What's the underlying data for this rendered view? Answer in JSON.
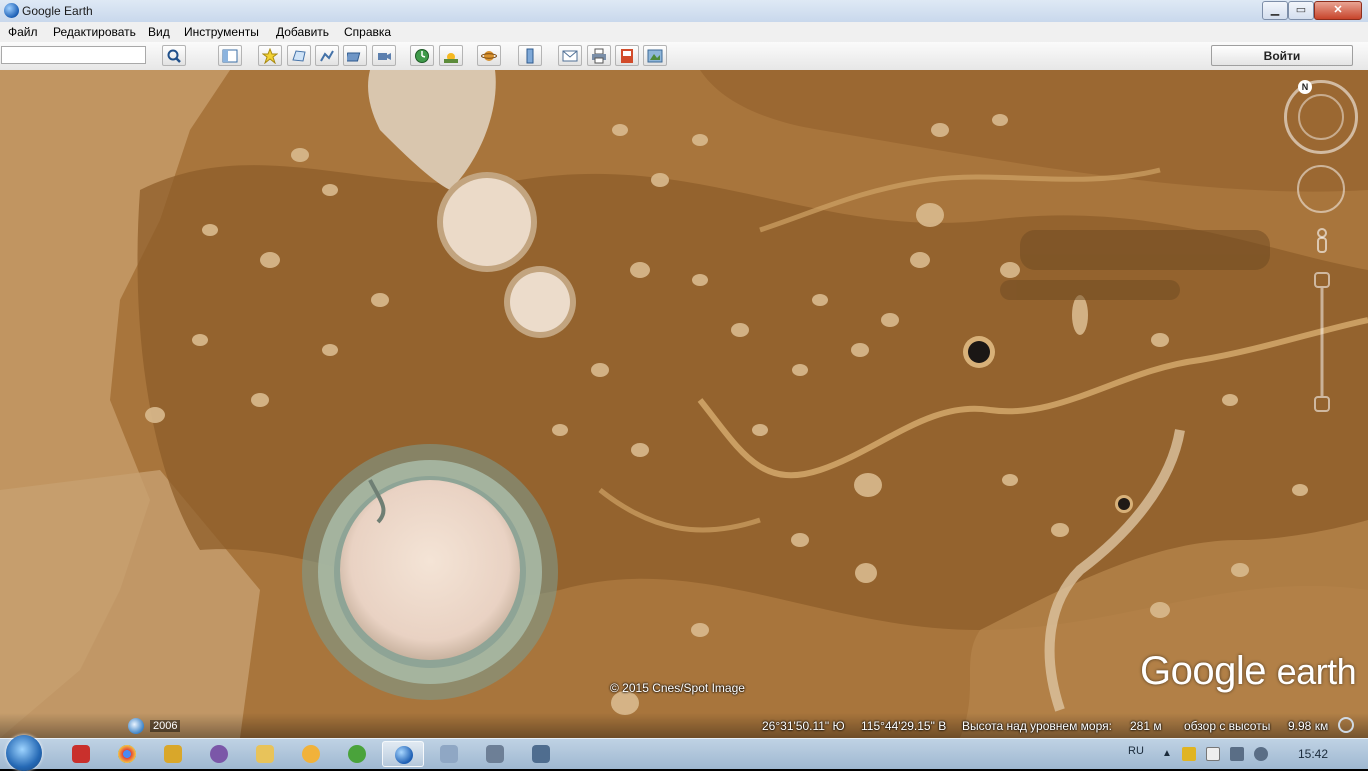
{
  "window": {
    "title": "Google Earth",
    "min_label": "▁",
    "max_label": "▭",
    "close_label": "✕"
  },
  "menu": [
    "Файл",
    "Редактировать",
    "Вид",
    "Инструменты",
    "Добавить",
    "Справка"
  ],
  "toolbar": {
    "search_value": "",
    "signin_label": "Войти",
    "icons": [
      "search-icon",
      "sidebar-toggle-icon",
      "placemark-icon",
      "polygon-icon",
      "path-icon",
      "overlay-icon",
      "tour-record-icon",
      "historical-imagery-icon",
      "sunlight-icon",
      "planets-icon",
      "ruler-icon",
      "email-icon",
      "print-icon",
      "save-image-icon",
      "view-in-maps-icon"
    ]
  },
  "map": {
    "copyright": "© 2015 Cnes/Spot Image",
    "logo_google": "Google",
    "logo_earth": "earth",
    "north_label": "N"
  },
  "status": {
    "imagery_year": "2006",
    "latitude": "26°31'50.11\" Ю",
    "longitude": "115°44'29.15\" В",
    "elevation_label": "Высота над уровнем моря:",
    "elevation_value": "281 м",
    "eye_alt_label": "обзор с высоты",
    "eye_alt_value": "9.98 км"
  },
  "taskbar": {
    "apps": [
      "flash-player-icon",
      "chrome-icon",
      "network-tool-icon",
      "viber-icon",
      "explorer-icon",
      "messenger-icon",
      "utorrent-icon",
      "google-earth-icon",
      "search-tool-icon",
      "usb-device-icon",
      "screen-tool-icon"
    ],
    "active_index": 7,
    "lang": "RU",
    "clock": "15:42"
  },
  "colors": {
    "terrain_base": "#a7743a",
    "terrain_dark": "#8a5a28",
    "salt_lake": "#e8d6c4",
    "status_text": "#ffffff"
  }
}
